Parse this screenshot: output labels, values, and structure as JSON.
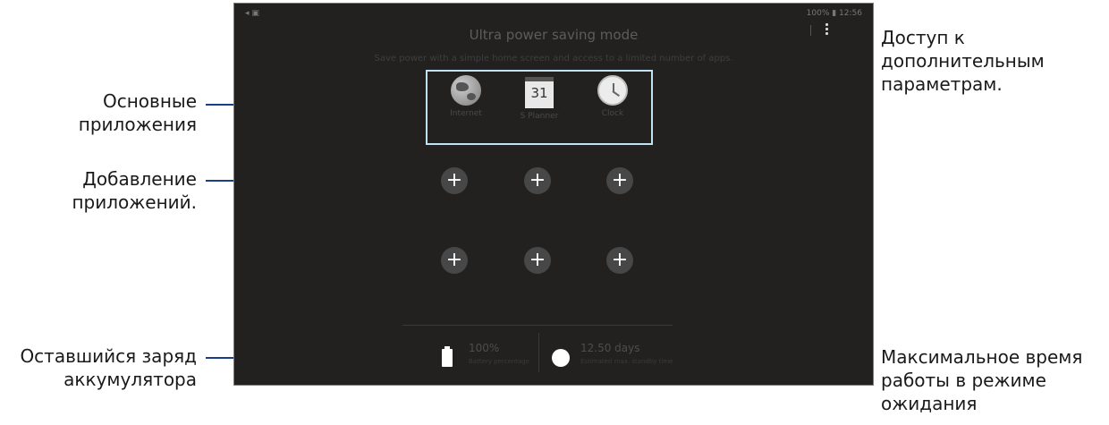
{
  "device_screen": {
    "status_left": "◂ ▣",
    "status_right": "100% ▮ 12:56",
    "title": "Ultra power saving mode",
    "description": "Save power with a simple home screen and access to a limited number of apps.",
    "more_icon": "more-vertical-icon",
    "apps": [
      {
        "icon": "globe-icon",
        "label": "Internet"
      },
      {
        "icon": "calendar-icon",
        "label": "S Planner",
        "day": "31"
      },
      {
        "icon": "clock-icon",
        "label": "Clock"
      }
    ],
    "add_button_glyph": "+",
    "add_buttons_count": 6,
    "battery": {
      "value": "100%",
      "caption": "Battery percentage"
    },
    "standby": {
      "value": "12.50 days",
      "caption": "Estimated max. standby time"
    }
  },
  "annotations": {
    "main_apps": [
      "Основные",
      "приложения"
    ],
    "add_apps": [
      "Добавление",
      "приложений."
    ],
    "battery_left": [
      "Оставшийся заряд",
      "аккумулятора"
    ],
    "more_options": [
      "Доступ к",
      "дополнительным",
      "параметрам."
    ],
    "max_standby": [
      "Максимальное время",
      "работы в режиме",
      "ожидания"
    ]
  },
  "colors": {
    "leader_line": "#1a3f87",
    "screen_bg": "#222120",
    "highlight_box": "#bfe3f5"
  }
}
